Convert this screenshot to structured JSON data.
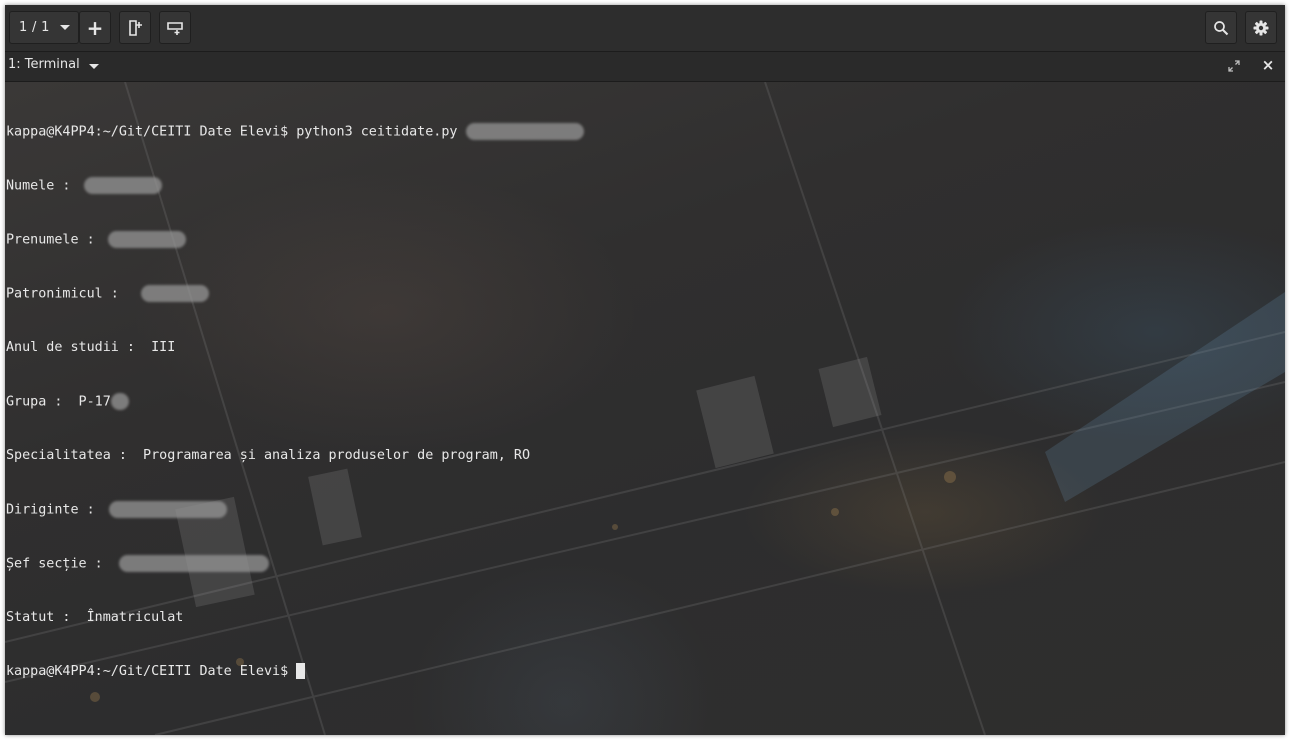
{
  "toolbar": {
    "terminal_counter": "1 / 1",
    "add_label": "+"
  },
  "tab": {
    "title": "1: Terminal",
    "close_label": "×"
  },
  "terminal": {
    "prompt": "kappa@K4PP4:~/Git/CEITI Date Elevi$",
    "command": " python3 ceitidate.py",
    "fields": [
      {
        "label": "Numele : ",
        "value": ""
      },
      {
        "label": "Prenumele : ",
        "value": ""
      },
      {
        "label": "Patronimicul : ",
        "value": ""
      },
      {
        "label": "Anul de studii : ",
        "value": " III"
      },
      {
        "label": "Grupa : ",
        "value": " P-17"
      },
      {
        "label": "Specialitatea : ",
        "value": " Programarea și analiza produselor de program, RO"
      },
      {
        "label": "Diriginte : ",
        "value": ""
      },
      {
        "label": "Șef secție : ",
        "value": ""
      },
      {
        "label": "Statut : ",
        "value": " Înmatriculat"
      }
    ]
  },
  "colors": {
    "window_bg": "#2d2d2d",
    "text": "#e8e8e8"
  },
  "icons": {
    "counter_caret": "chevron-down-icon",
    "add": "plus-icon",
    "split_vertical": "split-vertical-icon",
    "split_horizontal": "split-horizontal-icon",
    "search": "search-icon",
    "settings": "gear-icon",
    "maximize": "maximize-icon",
    "close": "close-icon"
  }
}
